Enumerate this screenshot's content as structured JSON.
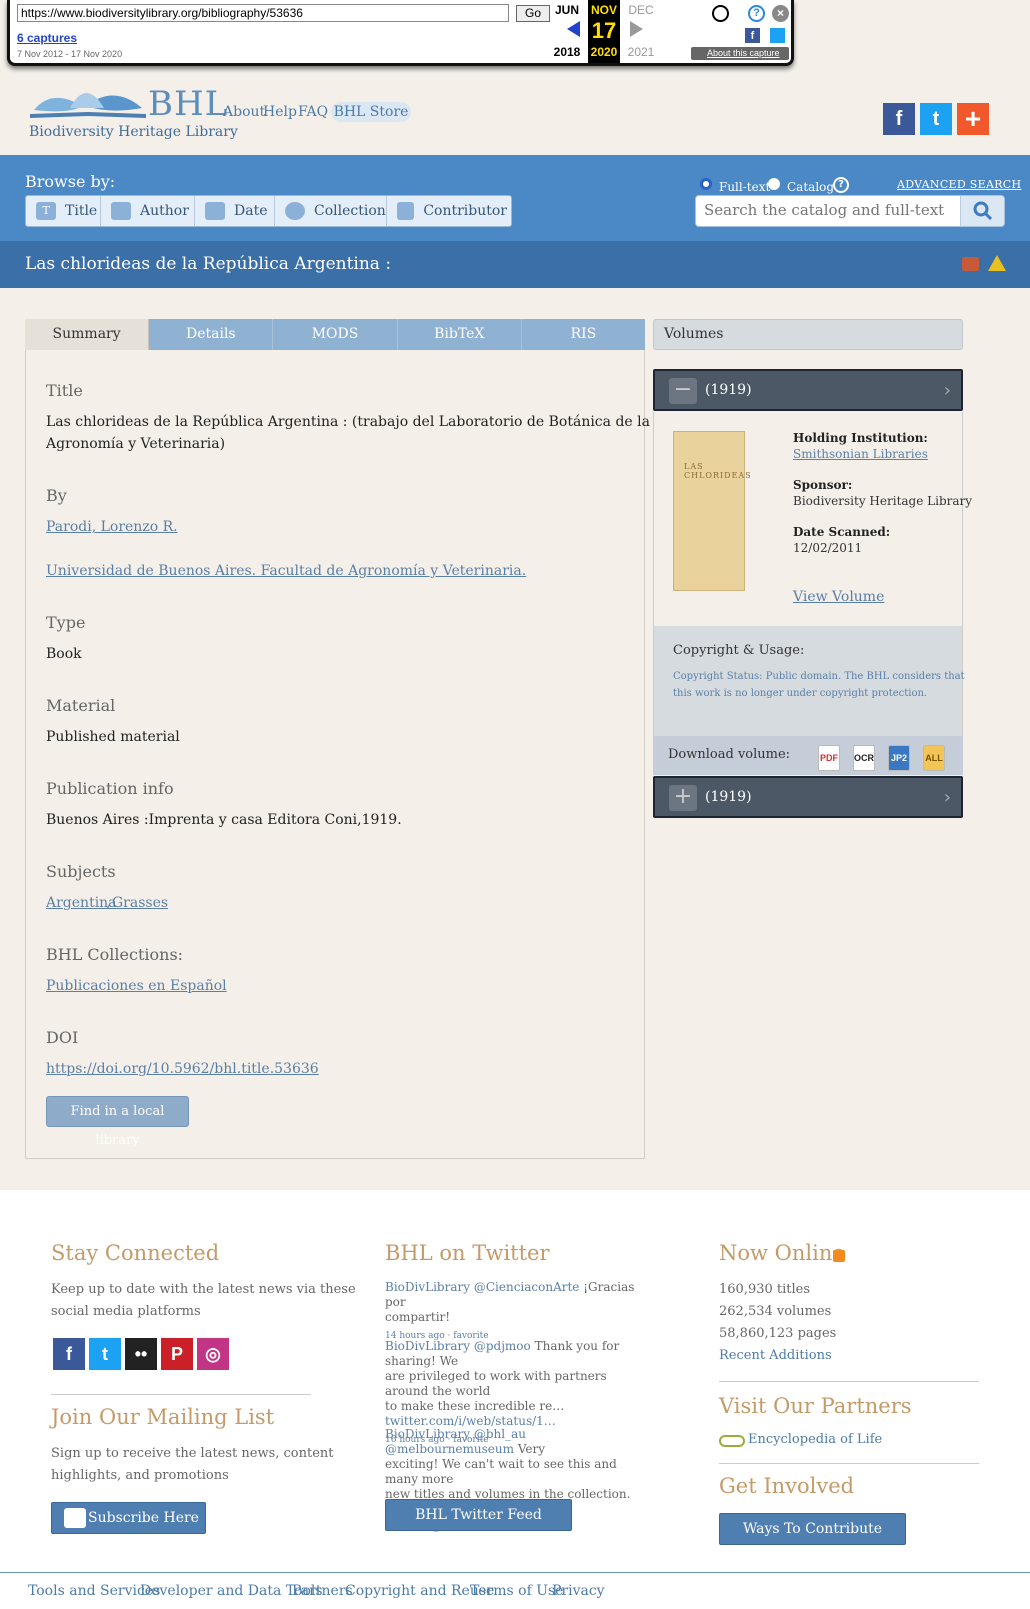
{
  "wayback": {
    "url": "https://www.biodiversitylibrary.org/bibliography/53636",
    "go": "Go",
    "captures": "6 captures",
    "range": "7 Nov 2012 - 17 Nov 2020",
    "months": [
      "JUN",
      "NOV",
      "DEC"
    ],
    "day": "17",
    "years": [
      "2018",
      "2020",
      "2021"
    ],
    "about": "About this capture"
  },
  "header": {
    "logo": "BHL",
    "logo_sub": "Biodiversity Heritage Library",
    "nav": [
      "About",
      "Help",
      "FAQ"
    ],
    "store": "BHL Store"
  },
  "browse": {
    "label": "Browse by:",
    "tabs": [
      "Title",
      "Author",
      "Date",
      "Collection",
      "Contributor"
    ],
    "radio_fulltext": "Full-text",
    "radio_catalog": "Catalog",
    "advanced": "ADVANCED SEARCH",
    "search_placeholder": "Search the catalog and full-text"
  },
  "page_title": "Las chlorideas de la República Argentina :",
  "tabs": [
    "Summary",
    "Details",
    "MODS",
    "BibTeX",
    "RIS"
  ],
  "summary": {
    "title_h": "Title",
    "title_l1": "Las chlorideas de la República Argentina : (trabajo del Laboratorio de Botánica de la Facultad de",
    "title_l2": "Agronomía y Veterinaria)",
    "by_h": "By",
    "author1": "Parodi, Lorenzo R.",
    "author2": "Universidad de Buenos Aires. Facultad de Agronomía y Veterinaria.",
    "type_h": "Type",
    "type": "Book",
    "material_h": "Material",
    "material": "Published material",
    "pub_h": "Publication info",
    "pub": "Buenos Aires :Imprenta y casa Editora Coni,1919.",
    "subjects_h": "Subjects",
    "subject1": "Argentina",
    "subject2": "Grasses",
    "coll_h": "BHL Collections:",
    "coll": "Publicaciones en Español",
    "doi_h": "DOI",
    "doi": "https://doi.org/10.5962/bhl.title.53636",
    "find": "Find in a local library"
  },
  "volumes": {
    "head": "Volumes",
    "vol1": "(1919)",
    "vol2": "(1919)",
    "holding_k": "Holding Institution:",
    "holding_v": "Smithsonian Libraries",
    "sponsor_k": "Sponsor:",
    "sponsor_v": "Biodiversity Heritage Library",
    "scanned_k": "Date Scanned:",
    "scanned_v": "12/02/2011",
    "view": "View Volume",
    "copy_h": "Copyright & Usage:",
    "copy_l1": "Copyright Status: Public domain. The BHL considers that",
    "copy_l2": "this work is no longer under copyright protection.",
    "download": "Download volume:",
    "formats": [
      "PDF",
      "OCR",
      "JP2",
      "ALL"
    ],
    "cover_title": "LAS CHLORIDEAS"
  },
  "footer": {
    "stay_h": "Stay Connected",
    "stay_l1": "Keep up to date with the latest news via these",
    "stay_l2": "social media platforms",
    "mail_h": "Join Our Mailing List",
    "mail_l1": "Sign up to receive the latest news, content",
    "mail_l2": "highlights, and promotions",
    "subscribe": "Subscribe Here",
    "tw_h": "BHL on Twitter",
    "tweets": [
      {
        "user": "BioDivLibrary",
        "mention": "@CienciaconArte",
        "l1": "¡Gracias por",
        "l2": "compartir!",
        "time": "14 hours ago · favorite"
      },
      {
        "user": "BioDivLibrary",
        "mention": "@pdjmoo",
        "l1": "Thank you for sharing! We",
        "l2": "are privileged to work with partners around the world",
        "l3": "to make these incredible re…",
        "link": "twitter.com/i/web/status/1…",
        "time": "16 hours ago · favorite"
      },
      {
        "user": "BioDivLibrary",
        "mention": "@bhl_au @melbournemuseum",
        "l1": "Very",
        "l2": "exciting! We can't wait to see this and many more",
        "l3": "new titles and volumes in the collection. 😊",
        "time": "16 hours ago · favorite"
      }
    ],
    "tw_btn": "BHL Twitter Feed",
    "online_h": "Now Online",
    "titles": "160,930 titles",
    "vols": "262,534 volumes",
    "pages": "58,860,123 pages",
    "recent": "Recent Additions",
    "partners_h": "Visit Our Partners",
    "eol": "Encyclopedia of Life",
    "involved_h": "Get Involved",
    "contribute": "Ways To Contribute",
    "links": [
      "Tools and Services",
      "Developer and Data Tools",
      "Partners",
      "Copyright and Reuse",
      "Terms of Use",
      "Privacy"
    ]
  }
}
